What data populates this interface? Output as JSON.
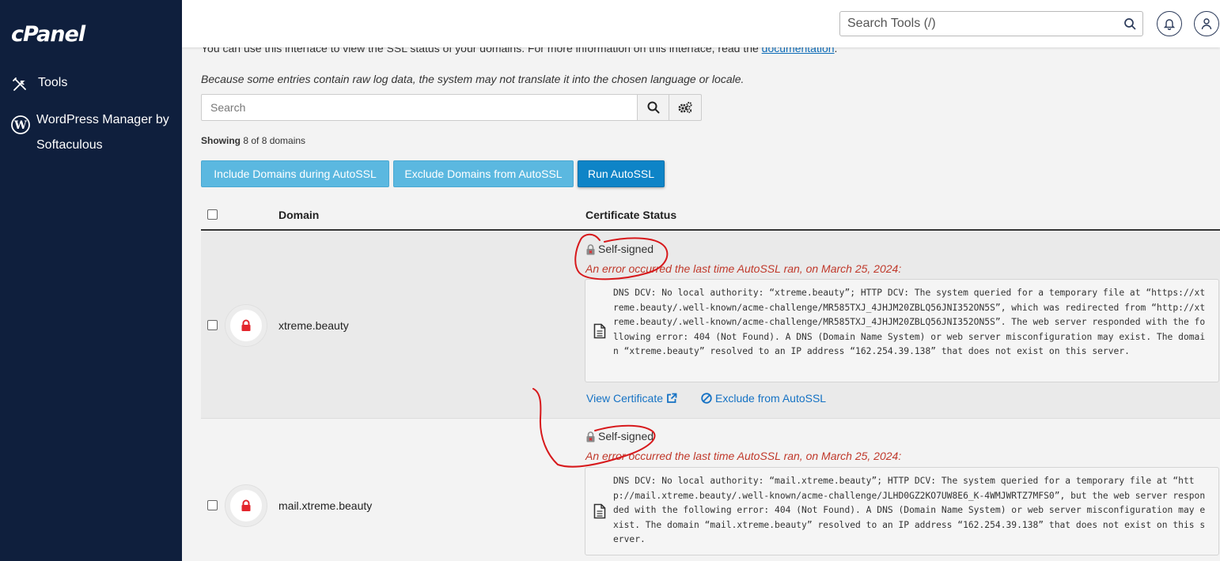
{
  "sidebar": {
    "logo": "cPanel",
    "items": [
      {
        "label": "Tools",
        "icon": "tools-icon"
      },
      {
        "label": "WordPress Manager by Softaculous",
        "icon": "wordpress-icon"
      }
    ]
  },
  "header": {
    "search_placeholder": "Search Tools (/)"
  },
  "main": {
    "intro_text": "You can use this interface to view the SSL status of your domains. For more information on this interface, read the ",
    "intro_link": "documentation",
    "intro_end": ".",
    "note": "Because some entries contain raw log data, the system may not translate it into the chosen language or locale.",
    "search_placeholder": "Search",
    "showing_label": "Showing",
    "showing_value": "8 of 8 domains",
    "buttons": {
      "include": "Include Domains during AutoSSL",
      "exclude": "Exclude Domains from AutoSSL",
      "run": "Run AutoSSL"
    },
    "table": {
      "headers": {
        "domain": "Domain",
        "status": "Certificate Status"
      },
      "rows": [
        {
          "domain": "xtreme.beauty",
          "status": "Self-signed",
          "error": "An error occurred the last time AutoSSL ran, on March 25, 2024:",
          "log": "DNS DCV: No local authority: “xtreme.beauty”; HTTP DCV: The system queried for a temporary file at “https://xtreme.beauty/.well-known/acme-challenge/MR585TXJ_4JHJM20ZBLQ56JNI352ON5S”, which was redirected from “http://xtreme.beauty/.well-known/acme-challenge/MR585TXJ_4JHJM20ZBLQ56JNI352ON5S”. The web server responded with the following error: 404 (Not Found). A DNS (Domain Name System) or web server misconfiguration may exist. The domain “xtreme.beauty” resolved to an IP address “162.254.39.138” that does not exist on this server.",
          "view_link": "View Certificate",
          "exclude_link": "Exclude from AutoSSL"
        },
        {
          "domain": "mail.xtreme.beauty",
          "status": "Self-signed",
          "error": "An error occurred the last time AutoSSL ran, on March 25, 2024:",
          "log": "DNS DCV: No local authority: “mail.xtreme.beauty”; HTTP DCV: The system queried for a temporary file at “http://mail.xtreme.beauty/.well-known/acme-challenge/JLHD0GZ2KO7UW8E6_K-4WMJWRTZ7MFS0”, but the web server responded with the following error: 404 (Not Found). A DNS (Domain Name System) or web server misconfiguration may exist. The domain “mail.xtreme.beauty” resolved to an IP address “162.254.39.138” that does not exist on this server."
        }
      ]
    }
  },
  "colors": {
    "sidebar_bg": "#0f1f3d",
    "button_light": "#5bb8e0",
    "button_primary": "#0e84c7",
    "error_red": "#c0392b",
    "lock_red": "#e3262c",
    "annotation_red": "#d7191c"
  }
}
